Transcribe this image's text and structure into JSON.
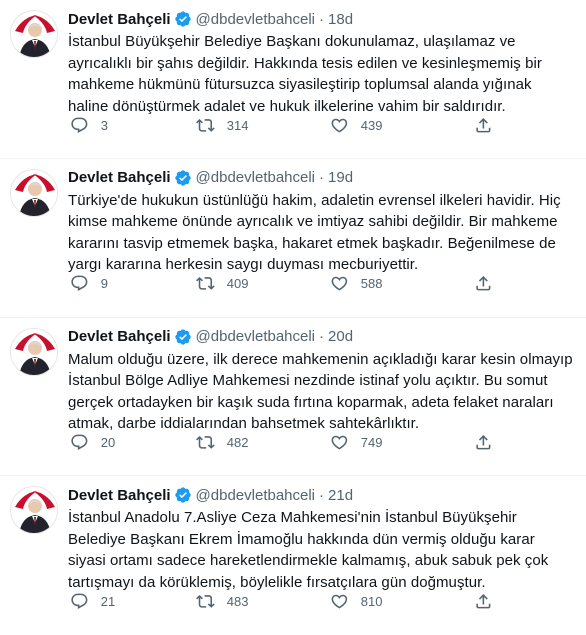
{
  "tweets": [
    {
      "author": "Devlet Bahçeli",
      "handle": "@dbdevletbahceli",
      "separator": "·",
      "time": "18d",
      "text": "İstanbul Büyükşehir Belediye Başkanı dokunulamaz, ulaşılamaz ve ayrıcalıklı bir şahıs değildir. Hakkında tesis edilen ve kesinleşmemiş bir mahkeme hükmünü fütursuzca siyasileştirip toplumsal alanda yığınak haline dönüştürmek adalet ve hukuk ilkelerine vahim bir saldırıdır.",
      "replies": "3",
      "retweets": "314",
      "likes": "439"
    },
    {
      "author": "Devlet Bahçeli",
      "handle": "@dbdevletbahceli",
      "separator": "·",
      "time": "19d",
      "text": "Türkiye'de hukukun üstünlüğü hakim, adaletin evrensel ilkeleri havidir. Hiç kimse mahkeme önünde ayrıcalık ve imtiyaz sahibi değildir. Bir mahkeme kararını tasvip etmemek başka, hakaret etmek başkadır. Beğenilmese de yargı kararına herkesin saygı duyması mecburiyettir.",
      "replies": "9",
      "retweets": "409",
      "likes": "588"
    },
    {
      "author": "Devlet Bahçeli",
      "handle": "@dbdevletbahceli",
      "separator": "·",
      "time": "20d",
      "text": "Malum olduğu üzere, ilk derece mahkemenin açıkladığı karar kesin olmayıp İstanbul Bölge Adliye Mahkemesi nezdinde istinaf yolu açıktır. Bu somut gerçek ortadayken bir kaşık suda fırtına koparmak, adeta felaket naraları atmak, darbe iddialarından bahsetmek sahtekârlıktır.",
      "replies": "20",
      "retweets": "482",
      "likes": "749"
    },
    {
      "author": "Devlet Bahçeli",
      "handle": "@dbdevletbahceli",
      "separator": "·",
      "time": "21d",
      "text": "İstanbul Anadolu 7.Asliye Ceza Mahkemesi'nin İstanbul Büyükşehir Belediye Başkanı Ekrem İmamoğlu hakkında dün vermiş olduğu karar siyasi ortamı sadece hareketlendirmekle kalmamış, abuk sabuk pek çok tartışmayı da körüklemiş, böylelikle fırsatçılara gün doğmuştur.",
      "replies": "21",
      "retweets": "483",
      "likes": "810"
    }
  ],
  "icons": {
    "verified": "verified-badge-icon",
    "reply": "reply-icon",
    "retweet": "retweet-icon",
    "like": "like-icon",
    "share": "share-icon"
  },
  "colors": {
    "text": "#0f1419",
    "secondary": "#536471",
    "verified": "#1d9bf0",
    "divider": "#eff3f4",
    "avatar_accent": "#c8102e"
  }
}
